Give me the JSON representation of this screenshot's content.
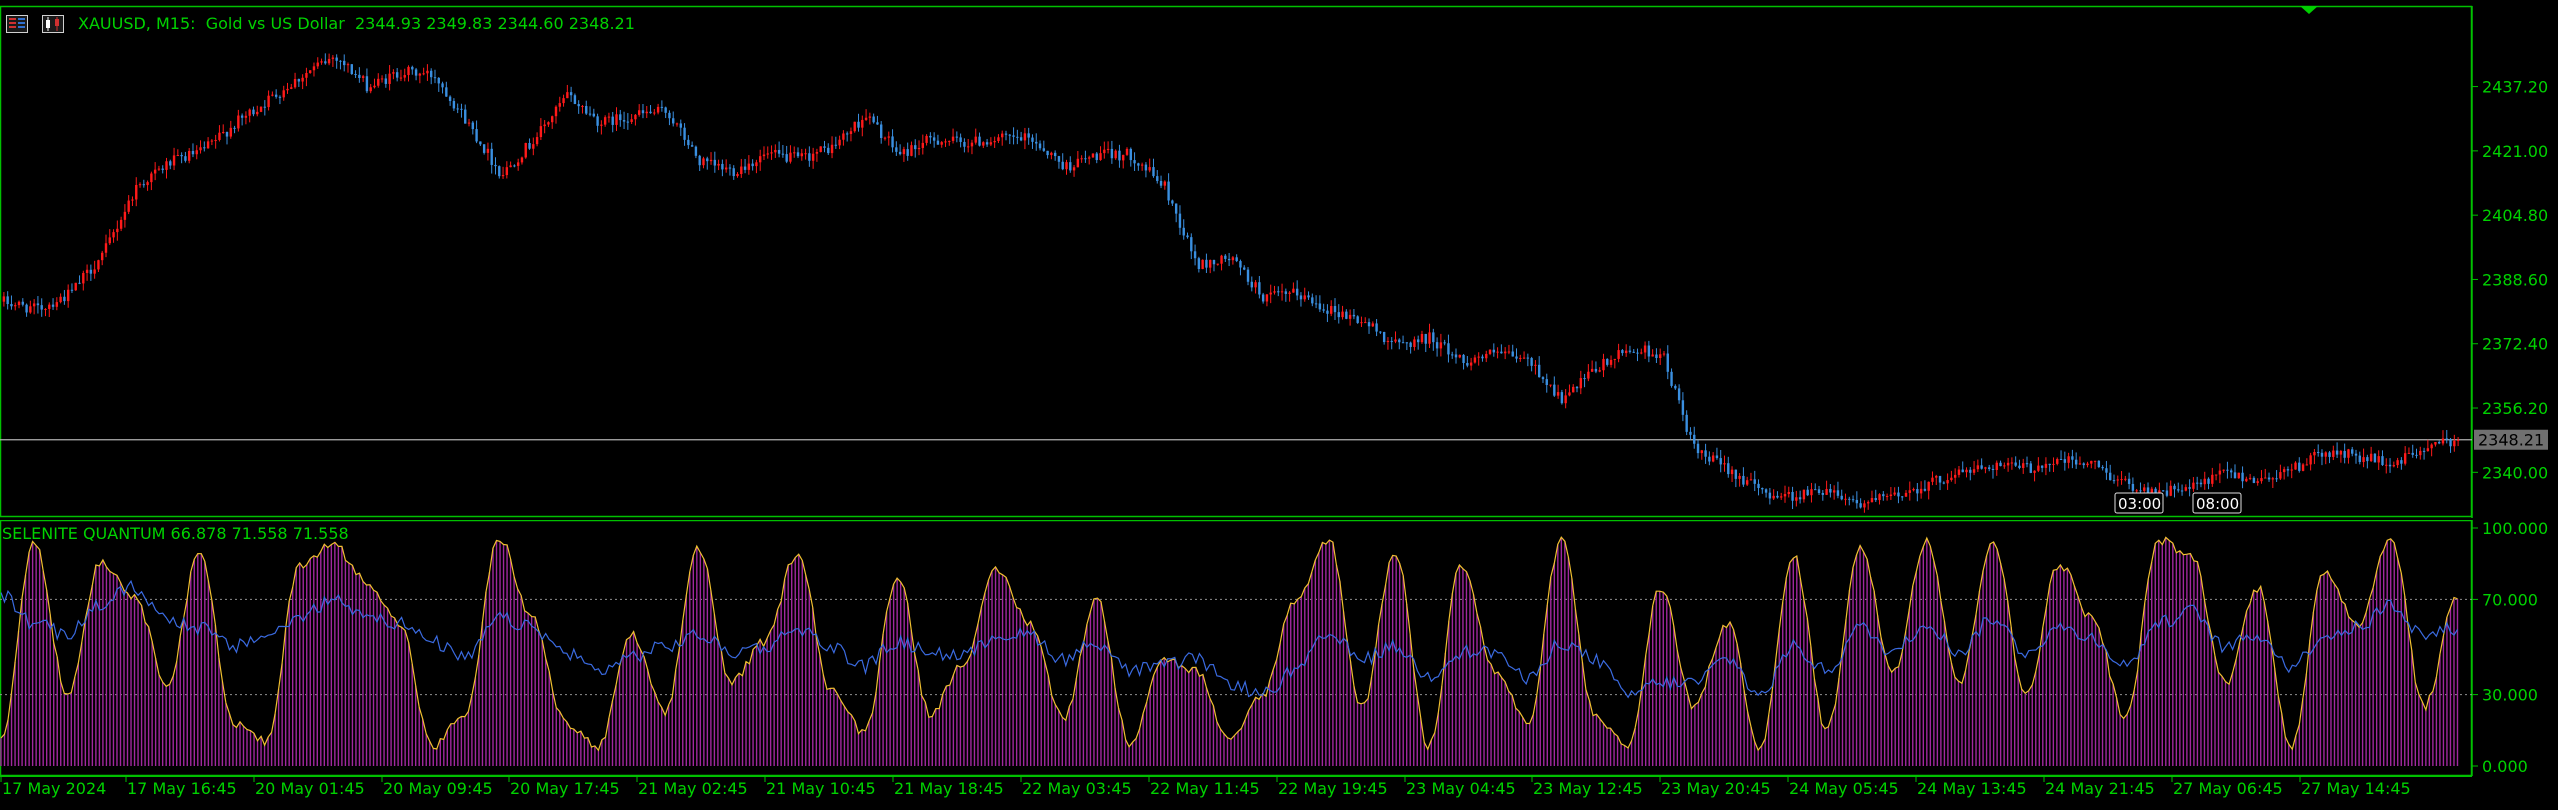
{
  "header": {
    "symbol": "XAUUSD, M15:",
    "description": "Gold vs US Dollar",
    "ohlc": "2344.93 2349.83 2344.60 2348.21"
  },
  "icons": {
    "bars": "bar-chart-icon",
    "candles": "candle-chart-icon"
  },
  "colors": {
    "bull": "#ff1a1a",
    "bear": "#3a8fe0",
    "frame": "#00c000",
    "axis_text": "#00d200",
    "histogram": "#a0289e",
    "osc_line": "#f0c030",
    "signal_line": "#3a6ae0",
    "price_line": "#b0b0b0"
  },
  "price_axis": {
    "ticks": [
      "2437.20",
      "2421.00",
      "2404.80",
      "2388.60",
      "2372.40",
      "2356.20",
      "2340.00"
    ],
    "tick_values": [
      2437.2,
      2421.0,
      2404.8,
      2388.6,
      2372.4,
      2356.2,
      2340.0
    ],
    "current_price": "2348.21",
    "current_value": 2348.21
  },
  "session_labels": [
    "03:00",
    "08:00"
  ],
  "indicator": {
    "name": "SELENITE QUANTUM",
    "values": "66.878 71.558 71.558",
    "ticks": [
      "100.000",
      "70.000",
      "30.000",
      "0.000"
    ],
    "levels": [
      70,
      30
    ]
  },
  "time_axis": {
    "labels": [
      "17 May 2024",
      "17 May 16:45",
      "20 May 01:45",
      "20 May 09:45",
      "20 May 17:45",
      "21 May 02:45",
      "21 May 10:45",
      "21 May 18:45",
      "22 May 03:45",
      "22 May 11:45",
      "22 May 19:45",
      "23 May 04:45",
      "23 May 12:45",
      "23 May 20:45",
      "24 May 05:45",
      "24 May 13:45",
      "24 May 21:45",
      "27 May 06:45",
      "27 May 14:45"
    ]
  },
  "chart_data": [
    {
      "type": "candlestick",
      "title": "XAUUSD, M15",
      "x": [
        "17 May 2024",
        "17 May 16:45",
        "20 May 01:45",
        "20 May 09:45",
        "20 May 17:45",
        "21 May 02:45",
        "21 May 10:45",
        "21 May 18:45",
        "22 May 03:45",
        "22 May 11:45",
        "22 May 19:45",
        "23 May 04:45",
        "23 May 12:45",
        "23 May 20:45",
        "24 May 05:45",
        "24 May 13:45",
        "24 May 21:45",
        "27 May 06:45",
        "27 May 14:45"
      ],
      "close": [
        2384,
        2420,
        2436,
        2441,
        2432,
        2417,
        2416,
        2427,
        2424,
        2418,
        2384,
        2368,
        2372,
        2334,
        2338,
        2343,
        2335,
        2344,
        2348.21
      ],
      "anchor_prices": [
        2383,
        2381,
        2385,
        2395,
        2412,
        2418,
        2421,
        2428,
        2434,
        2440,
        2445,
        2437,
        2441,
        2440,
        2428,
        2415,
        2424,
        2435,
        2428,
        2430,
        2431,
        2418,
        2416,
        2420,
        2419,
        2422,
        2430,
        2420,
        2424,
        2423,
        2424,
        2424,
        2417,
        2420,
        2420,
        2412,
        2392,
        2394,
        2384,
        2385,
        2381,
        2378,
        2372,
        2374,
        2368,
        2370,
        2368,
        2358,
        2366,
        2371,
        2370,
        2345,
        2341,
        2335,
        2334,
        2336,
        2332,
        2334,
        2337,
        2340,
        2342,
        2341,
        2343,
        2342,
        2337,
        2335,
        2336,
        2340,
        2338,
        2341,
        2345,
        2344,
        2342,
        2346,
        2348.21
      ],
      "ylim": [
        2330,
        2457
      ]
    },
    {
      "type": "area",
      "title": "SELENITE QUANTUM",
      "ylim": [
        0,
        100
      ],
      "levels": [
        70,
        30
      ],
      "last_values": [
        66.878,
        71.558,
        71.558
      ],
      "oscillator_anchors": [
        12,
        95,
        30,
        86,
        72,
        35,
        90,
        18,
        10,
        85,
        93,
        78,
        60,
        8,
        22,
        96,
        62,
        18,
        8,
        55,
        22,
        92,
        35,
        52,
        90,
        32,
        14,
        80,
        22,
        44,
        82,
        60,
        20,
        70,
        10,
        45,
        40,
        10,
        30,
        70,
        95,
        25,
        90,
        8,
        85,
        40,
        18,
        95,
        22,
        8,
        75,
        25,
        60,
        8,
        88,
        15,
        92,
        40,
        95,
        35,
        95,
        30,
        85,
        62,
        20,
        95,
        88,
        35,
        75,
        8,
        82,
        60,
        96,
        25,
        72
      ],
      "signal_anchors": [
        72,
        60,
        55,
        68,
        75,
        62,
        58,
        50,
        55,
        62,
        70,
        64,
        60,
        52,
        45,
        62,
        58,
        48,
        40,
        46,
        50,
        55,
        48,
        50,
        58,
        50,
        42,
        52,
        48,
        46,
        55,
        55,
        45,
        52,
        40,
        42,
        45,
        35,
        30,
        40,
        55,
        45,
        50,
        38,
        48,
        48,
        36,
        52,
        45,
        30,
        35,
        35,
        45,
        30,
        50,
        40,
        58,
        48,
        60,
        48,
        62,
        48,
        58,
        54,
        42,
        60,
        65,
        50,
        55,
        42,
        55,
        58,
        68,
        55,
        58
      ]
    }
  ]
}
